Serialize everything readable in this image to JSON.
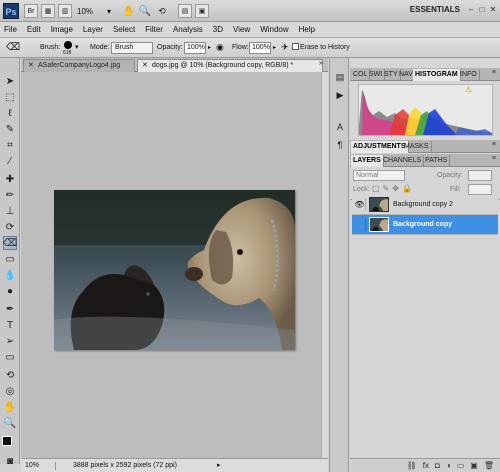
{
  "app": {
    "logo": "Ps",
    "zoom": "10%",
    "workspace": "ESSENTIALS"
  },
  "menu": [
    "File",
    "Edit",
    "Image",
    "Layer",
    "Select",
    "Filter",
    "Analysis",
    "3D",
    "View",
    "Window",
    "Help"
  ],
  "options": {
    "brush_label": "Brush:",
    "brush_size": "618",
    "mode_label": "Mode:",
    "mode_value": "Brush",
    "opacity_label": "Opacity:",
    "opacity_value": "100%",
    "flow_label": "Flow:",
    "flow_value": "100%",
    "erase_history": "Erase to History"
  },
  "documents": {
    "tabs": [
      {
        "label": "ASaferCompanyLogo4.jpg",
        "active": false
      },
      {
        "label": "dogs.jpg @ 10% (Background copy, RGB/8) *",
        "active": true
      }
    ]
  },
  "status": {
    "zoom": "10%",
    "info": "3888 pixels x 2592 pixels (72 ppi)"
  },
  "panels": {
    "top_tabs": [
      "COL",
      "SWI",
      "STY",
      "NAV",
      "HISTOGRAM",
      "INFO"
    ],
    "adjust_tabs": [
      "ADJUSTMENTS",
      "MASKS"
    ],
    "layer_tabs": [
      "LAYERS",
      "CHANNELS",
      "PATHS"
    ],
    "blend_mode": "Normal",
    "opacity_label": "Opacity:",
    "lock_label": "Lock:",
    "fill_label": "Fill:",
    "layers": [
      {
        "name": "Background copy 2",
        "selected": false,
        "visible": true
      },
      {
        "name": "Background copy",
        "selected": true,
        "visible": false
      }
    ]
  },
  "colors": {
    "accent_selected": "#3f8fe4",
    "ps_blue": "#1b3b66"
  }
}
